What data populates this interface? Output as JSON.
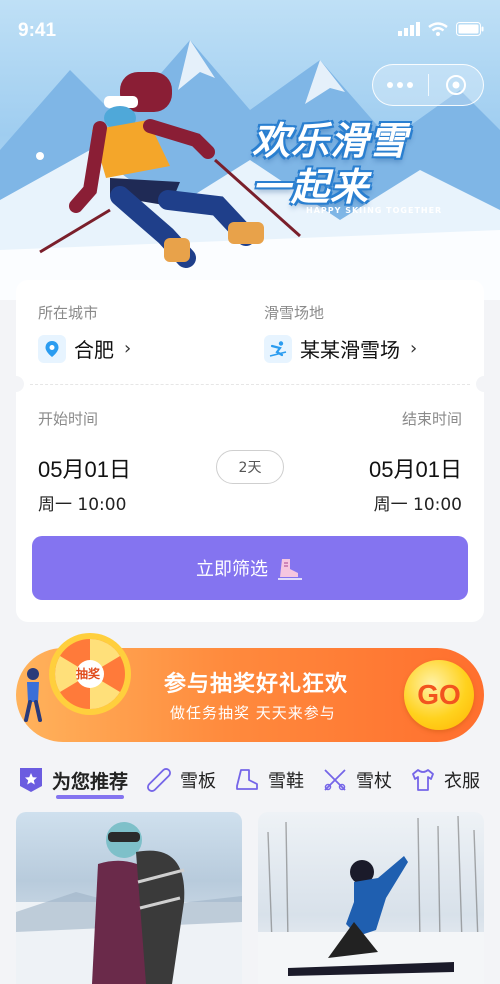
{
  "status": {
    "time": "9:41"
  },
  "hero": {
    "title_line1": "欢乐滑雪",
    "title_line2": "一起来",
    "subtitle": "HAPPY SKIING TOGETHER"
  },
  "booking": {
    "city_label": "所在城市",
    "city_value": "合肥",
    "venue_label": "滑雪场地",
    "venue_value": "某某滑雪场",
    "start_label": "开始时间",
    "end_label": "结束时间",
    "start_date": "05月01日",
    "start_time": "周一 10:00",
    "end_date": "05月01日",
    "end_time": "周一 10:00",
    "duration": "2天",
    "filter_label": "立即筛选"
  },
  "promo": {
    "wheel_label": "抽奖",
    "title": "参与抽奖好礼狂欢",
    "subtitle": "做任务抽奖 天天来参与",
    "go_label": "GO"
  },
  "categories": [
    {
      "label": "为您推荐",
      "icon": "star-badge-icon",
      "active": true
    },
    {
      "label": "雪板",
      "icon": "snowboard-icon",
      "active": false
    },
    {
      "label": "雪鞋",
      "icon": "boot-icon",
      "active": false
    },
    {
      "label": "雪杖",
      "icon": "ski-poles-icon",
      "active": false
    },
    {
      "label": "衣服",
      "icon": "shirt-icon",
      "active": false
    }
  ],
  "colors": {
    "accent": "#8474f0",
    "promo_orange": "#ff8a3d",
    "go_text": "#f2541f"
  }
}
